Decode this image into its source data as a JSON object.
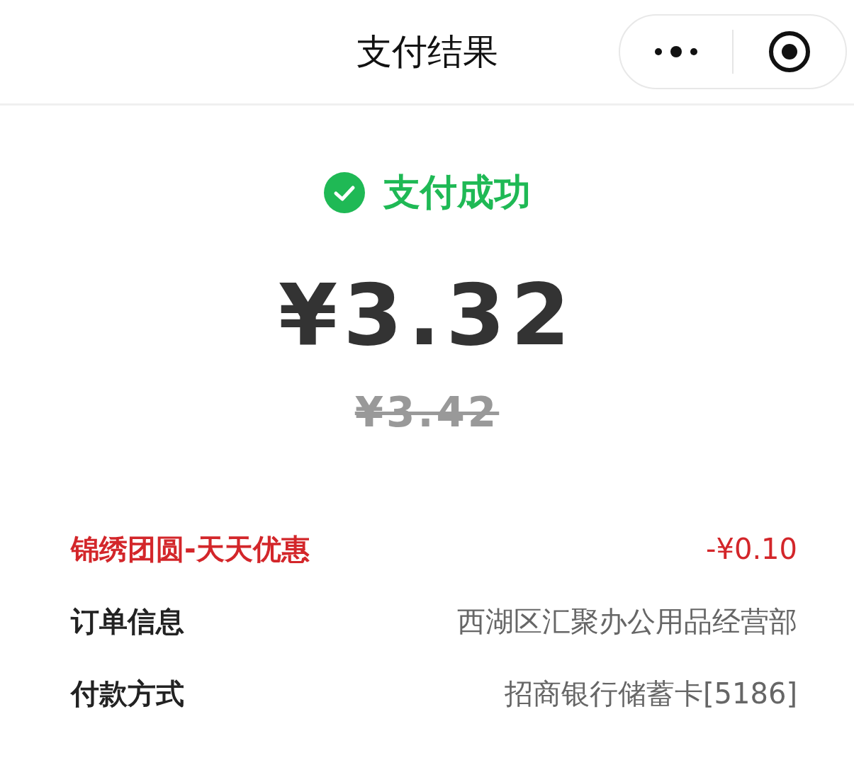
{
  "header": {
    "title": "支付结果"
  },
  "status": {
    "kind": "success",
    "text": "支付成功"
  },
  "amount": "¥3.32",
  "original_amount": "¥3.42",
  "details": [
    {
      "kind": "discount",
      "label": "锦绣团圆-天天优惠",
      "value": "-¥0.10"
    },
    {
      "kind": "info",
      "label": "订单信息",
      "value": "西湖区汇聚办公用品经营部"
    },
    {
      "kind": "info",
      "label": "付款方式",
      "value": "招商银行储蓄卡[5186]"
    }
  ]
}
